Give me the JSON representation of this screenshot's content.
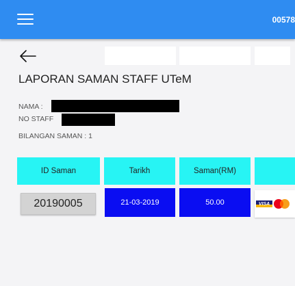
{
  "appbar": {
    "menu_icon": "hamburger-menu-icon",
    "code": "00578"
  },
  "nav": {
    "back_icon": "arrow-left-icon"
  },
  "page": {
    "title": "LAPORAN SAMAN STAFF UTeM",
    "nama_label": "NAMA :",
    "nostaff_label": "NO STAFF",
    "bilangan_label": "BILANGAN SAMAN : 1"
  },
  "table": {
    "headers": [
      "ID Saman",
      "Tarikh",
      "Saman(RM)",
      ""
    ],
    "rows": [
      {
        "id": "20190005",
        "tarikh": "21-03-2019",
        "saman": "50.00",
        "payment_icon": "visa-mastercard-icon"
      }
    ]
  },
  "colors": {
    "appbar": "#2f8cf1",
    "header_cell": "#27f4f4",
    "value_cell": "#0a0df2",
    "id_cell": "#d3d3d3"
  }
}
